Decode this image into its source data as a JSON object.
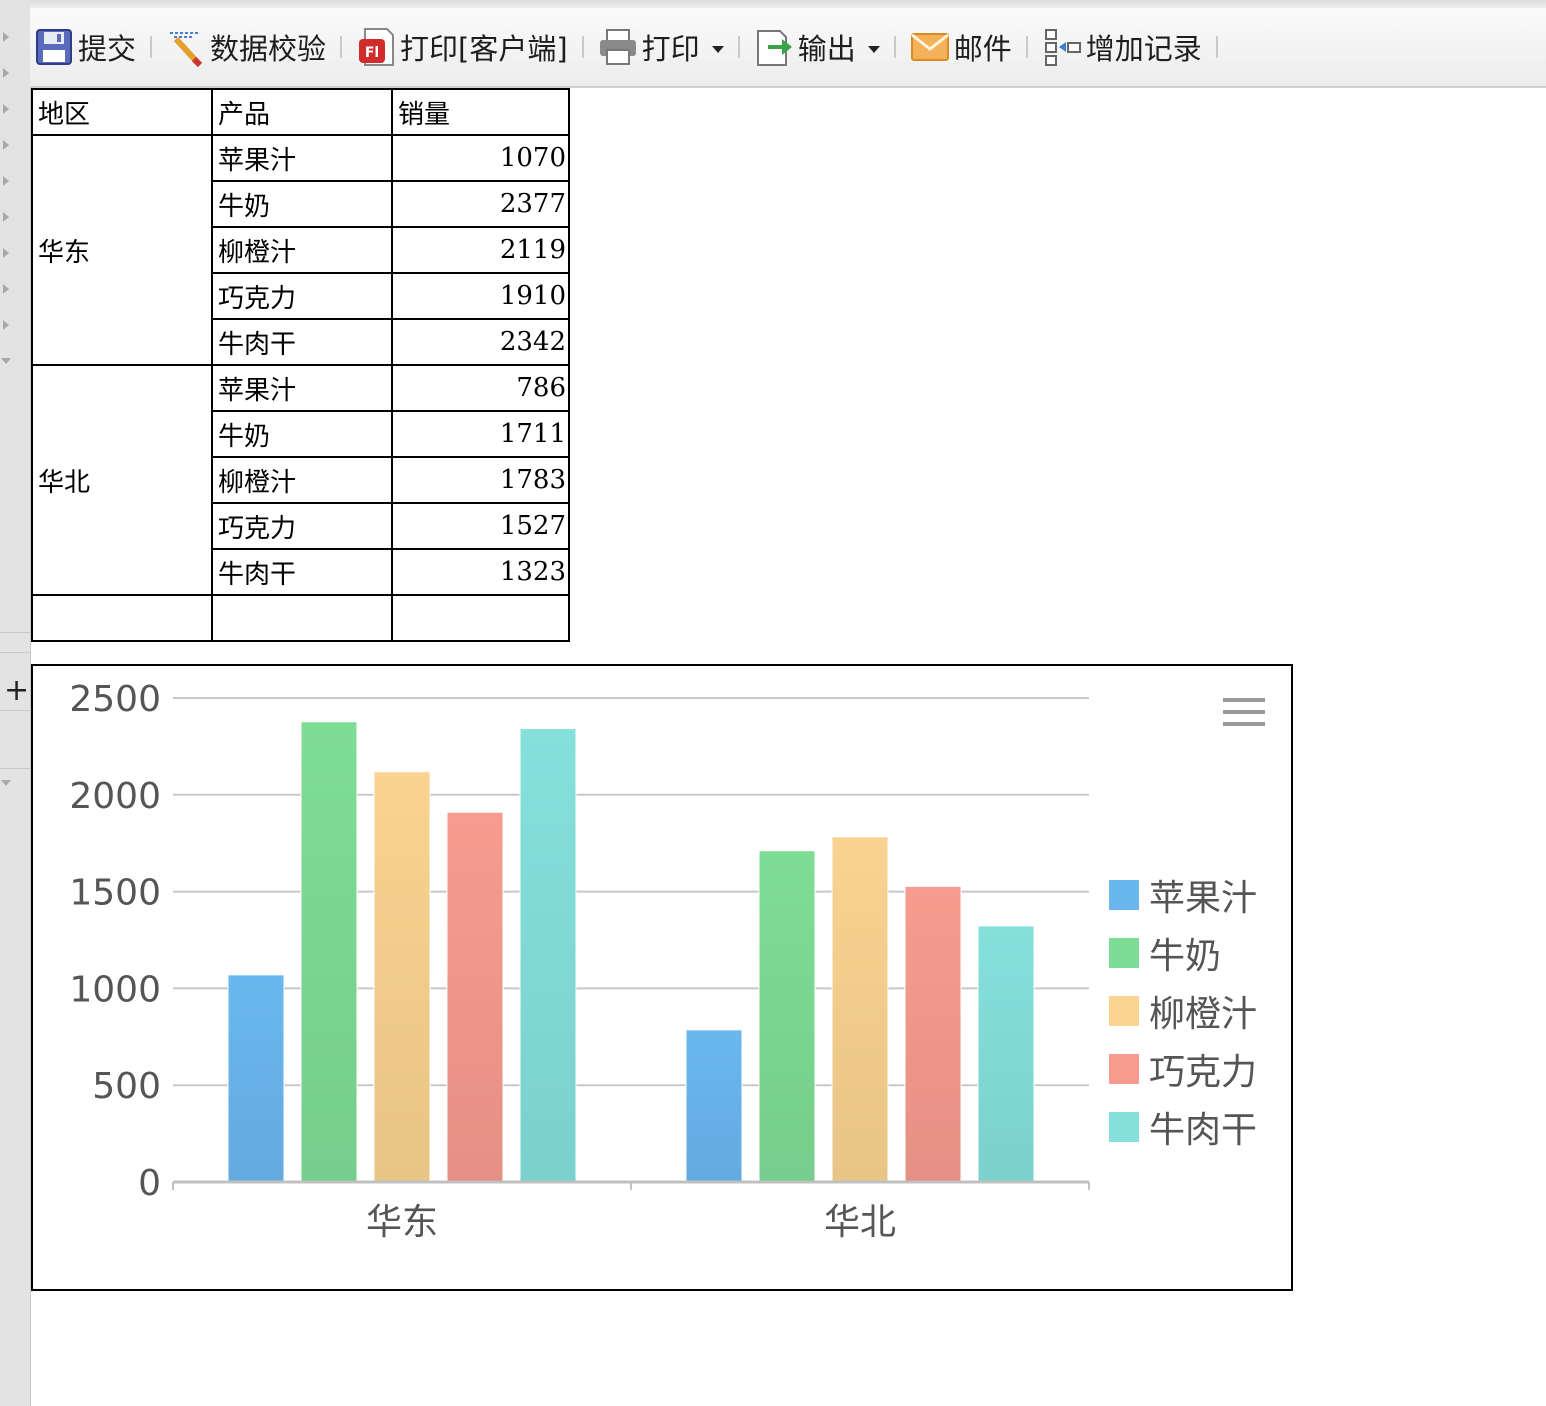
{
  "toolbar": {
    "items": [
      {
        "label": "提交",
        "icon": "save-icon",
        "has_menu": false
      },
      {
        "label": "数据校验",
        "icon": "data-check-icon",
        "has_menu": false
      },
      {
        "label": "打印[客户端]",
        "icon": "flash-print-icon",
        "has_menu": false
      },
      {
        "label": "打印",
        "icon": "printer-icon",
        "has_menu": true
      },
      {
        "label": "输出",
        "icon": "export-icon",
        "has_menu": true
      },
      {
        "label": "邮件",
        "icon": "mail-icon",
        "has_menu": false
      },
      {
        "label": "增加记录",
        "icon": "add-record-icon",
        "has_menu": false
      }
    ]
  },
  "table": {
    "headers": [
      "地区",
      "产品",
      "销量"
    ],
    "groups": [
      {
        "region": "华东",
        "rows": [
          {
            "product": "苹果汁",
            "sales": "1070"
          },
          {
            "product": "牛奶",
            "sales": "2377"
          },
          {
            "product": "柳橙汁",
            "sales": "2119"
          },
          {
            "product": "巧克力",
            "sales": "1910"
          },
          {
            "product": "牛肉干",
            "sales": "2342"
          }
        ]
      },
      {
        "region": "华北",
        "rows": [
          {
            "product": "苹果汁",
            "sales": "786"
          },
          {
            "product": "牛奶",
            "sales": "1711"
          },
          {
            "product": "柳橙汁",
            "sales": "1783"
          },
          {
            "product": "巧克力",
            "sales": "1527"
          },
          {
            "product": "牛肉干",
            "sales": "1323"
          }
        ]
      }
    ]
  },
  "chart_data": {
    "type": "bar",
    "title": "",
    "xlabel": "",
    "ylabel": "",
    "categories": [
      "华东",
      "华北"
    ],
    "ylim": [
      0,
      2500
    ],
    "yticks": [
      0,
      500,
      1000,
      1500,
      2000,
      2500
    ],
    "grid": true,
    "legend_position": "right",
    "series": [
      {
        "name": "苹果汁",
        "values": [
          1070,
          786
        ],
        "color": "#6ab7f0"
      },
      {
        "name": "牛奶",
        "values": [
          2377,
          1711
        ],
        "color": "#7edd95"
      },
      {
        "name": "柳橙汁",
        "values": [
          2119,
          1783
        ],
        "color": "#f9d38f"
      },
      {
        "name": "巧克力",
        "values": [
          1910,
          1527
        ],
        "color": "#f79b8f"
      },
      {
        "name": "牛肉干",
        "values": [
          2342,
          1323
        ],
        "color": "#85e0dc"
      }
    ]
  }
}
